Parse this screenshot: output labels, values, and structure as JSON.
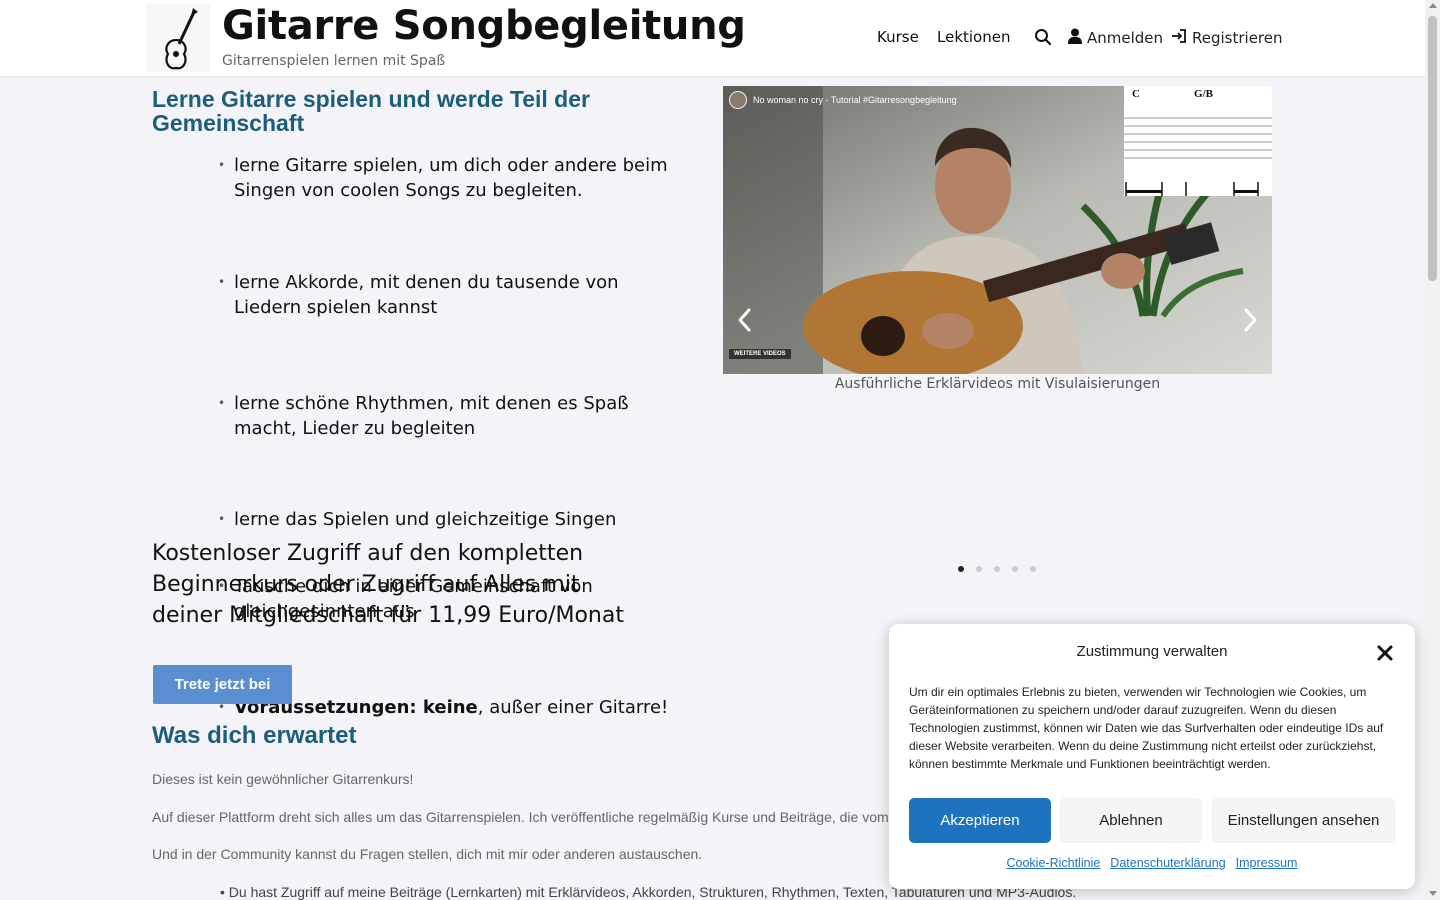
{
  "header": {
    "site_title": "Gitarre Songbegleitung",
    "tagline": "Gitarrenspielen lernen mit Spaß",
    "nav": {
      "kurse": "Kurse",
      "lektionen": "Lektionen",
      "login": "Anmelden",
      "register": "Registrieren"
    },
    "icons": [
      "guitar-logo",
      "search-icon",
      "user-icon",
      "sign-in-icon"
    ]
  },
  "hero": {
    "heading": "Lerne Gitarre spielen und werde Teil der Gemeinschaft",
    "features": [
      "lerne Gitarre spielen, um dich oder andere beim Singen von coolen Songs zu begleiten.",
      "lerne Akkorde, mit denen du tausende von Liedern spielen kannst",
      "lerne schöne Rhythmen, mit denen es Spaß macht, Lieder zu begleiten",
      "lerne das Spielen und gleichzeitige Singen",
      "Tausche dich in einer Gemeinschaft von gleichgesinnten aus"
    ],
    "prerequisite_bold": "Voraussetzungen: keine",
    "prerequisite_rest": ", außer einer Gitarre!",
    "offer": "Kostenloser Zugriff auf den kompletten Beginnerkurs oder Zugriff auf Alles mit deiner Mitgliedschaft für 11,99 Euro/Monat",
    "cta": "Trete jetzt bei"
  },
  "carousel": {
    "video_title": "No woman no cry - Tutorial #Gitarresongbegleitung",
    "video_more": "WEITERE VIDEOS",
    "chord_left": "C",
    "chord_right": "G/B",
    "caption": "Ausführliche Erklärvideos mit Visulaisierungen",
    "slide_count": 5,
    "active_slide": 1
  },
  "section": {
    "heading": "Was dich erwartet",
    "para_1": "Dieses ist kein gewöhnlicher Gitarrenkurs!",
    "para_2": "Auf dieser Plattform dreht sich alles um das Gitarrenspielen. Ich veröffentliche regelmäßig Kurse und Beiträge, die vom",
    "para_3": "Und in der Community kannst du Fragen stellen, dich mit mir oder anderen austauschen.",
    "bullet_1": "Du hast Zugriff auf meine Beiträge (Lernkarten) mit Erklärvideos, Akkorden, Strukturen, Rhythmen, Texten, Tabulaturen und MP3-Audios."
  },
  "cookie": {
    "title": "Zustimmung verwalten",
    "text": "Um dir ein optimales Erlebnis zu bieten, verwenden wir Technologien wie Cookies, um Geräteinformationen zu speichern und/oder darauf zuzugreifen. Wenn du diesen Technologien zustimmst, können wir Daten wie das Surfverhalten oder eindeutige IDs auf dieser Website verarbeiten. Wenn du deine Zustimmung nicht erteilst oder zurückziehst, können bestimmte Merkmale und Funktionen beeinträchtigt werden.",
    "accept": "Akzeptieren",
    "deny": "Ablehnen",
    "settings": "Einstellungen ansehen",
    "links": [
      "Cookie-Richtlinie",
      "Datenschuterklärung",
      "Impressum"
    ]
  },
  "colors": {
    "heading": "#1b5d7a",
    "cta": "#5b8ed0",
    "accept": "#1e73be",
    "background": "#f4f4f8"
  }
}
